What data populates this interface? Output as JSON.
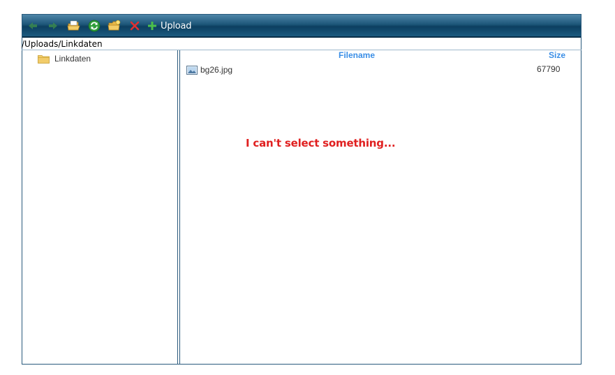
{
  "toolbar": {
    "buttons": [
      {
        "icon": "back-arrow-icon"
      },
      {
        "icon": "forward-arrow-icon"
      },
      {
        "icon": "open-folder-icon"
      },
      {
        "icon": "refresh-icon"
      },
      {
        "icon": "new-folder-icon"
      },
      {
        "icon": "delete-icon"
      }
    ],
    "upload_label": "Upload"
  },
  "path": "/Uploads/Linkdaten",
  "tree": {
    "items": [
      {
        "label": "Linkdaten",
        "icon": "folder-icon"
      }
    ]
  },
  "grid": {
    "columns": [
      "Filename",
      "Size"
    ],
    "rows": [
      {
        "name": "bg26.jpg",
        "size": "67790",
        "icon": "image-file-icon"
      }
    ]
  },
  "annotation": "I can't select something...",
  "colors": {
    "toolbar_bg": "#1d5679",
    "header_text": "#3a8ee6",
    "annotation": "#e02020"
  }
}
